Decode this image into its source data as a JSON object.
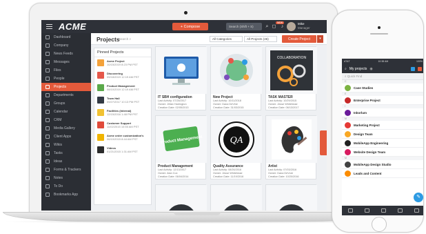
{
  "colors": {
    "accent": "#e35a3b",
    "sidebar": "#2b2e34",
    "topbar": "#2e3138",
    "fab": "#2d9be3"
  },
  "app": {
    "logo": "ACME",
    "compose_label": "+ Compose",
    "search_placeholder": "Search (Shift + S)",
    "badge_new": "NEW",
    "user_name": "Mike",
    "user_role": "Manager"
  },
  "sidebar": {
    "items": [
      {
        "label": "Dashboard",
        "icon": "dashboard-icon"
      },
      {
        "label": "Company",
        "icon": "company-icon"
      },
      {
        "label": "News Feeds",
        "icon": "news-icon"
      },
      {
        "label": "Messages",
        "icon": "messages-icon"
      },
      {
        "label": "Files",
        "icon": "files-icon"
      },
      {
        "label": "People",
        "icon": "people-icon"
      },
      {
        "label": "Projects",
        "icon": "projects-icon",
        "active": true
      },
      {
        "label": "Departments",
        "icon": "departments-icon"
      },
      {
        "label": "Groups",
        "icon": "groups-icon"
      },
      {
        "label": "Calendar",
        "icon": "calendar-icon"
      },
      {
        "label": "CRM",
        "icon": "crm-icon"
      },
      {
        "label": "Media Gallery",
        "icon": "media-icon"
      },
      {
        "label": "Client Apps",
        "icon": "apps-icon"
      },
      {
        "label": "Wikis",
        "icon": "wiki-icon"
      },
      {
        "label": "Tasks",
        "icon": "tasks-icon"
      },
      {
        "label": "Ideas",
        "icon": "ideas-icon"
      },
      {
        "label": "Forms & Trackers",
        "icon": "forms-icon"
      },
      {
        "label": "Notes",
        "icon": "notes-icon"
      },
      {
        "label": "To Do",
        "icon": "todo-icon"
      },
      {
        "label": "Bookmarks App",
        "icon": "bookmarks-icon"
      }
    ]
  },
  "projects": {
    "title": "Projects",
    "search_label": "Search",
    "category_select": "All Categories",
    "projects_select": "All Projects (46)",
    "create_label": "Create Project"
  },
  "pinned": {
    "title": "Pinned Projects",
    "items": [
      {
        "name": "Acme Project",
        "date": "10/15/2019 8:23 PM PST",
        "thumb": "#f4a23a"
      },
      {
        "name": "Discovering",
        "date": "09/18/2019 12:19 AM PST",
        "thumb": "#e5574a"
      },
      {
        "name": "Product Management",
        "date": "08/10/2019 12:19 AM PST",
        "thumb": "#5aa94a"
      },
      {
        "name": "Town Hall",
        "date": "09/27/2017 10:13 PM PST",
        "thumb": "#333a44"
      },
      {
        "name": "Facilities (Internal)",
        "date": "12/15/2016 1:48 PM PST",
        "thumb": "#f1c232"
      },
      {
        "name": "Customer Support",
        "date": "11/02/2015 10:55 AM PST",
        "thumb": "#e04a3a"
      },
      {
        "name": "Acme order customization's",
        "date": "06/10/2015 8:44 AM PST",
        "thumb": "#f0b400"
      },
      {
        "name": "Videos",
        "date": "01/21/2015 1:31 AM PST",
        "thumb": "#2b2b2b"
      }
    ]
  },
  "cards": [
    {
      "title": "IT SBH configuration",
      "last": "Last Activity: 07/28/2017",
      "owner": "Owner: Jillian Harrington",
      "created": "Creation Date: 02/05/2013",
      "img": "monitor"
    },
    {
      "title": "New Project",
      "last": "Last Activity: 10/11/2018",
      "owner": "Owner: Dana DeVine",
      "created": "Creation Date: 31/03/2015",
      "img": "globe"
    },
    {
      "title": "TASK MASTER",
      "last": "Last Activity: 10/29/2015",
      "owner": "Owner: Jesse Whitehead",
      "created": "Creation Date: 06/13/2017",
      "img": "gears",
      "banner": "COLLABORATION"
    },
    {
      "title": "Product Management",
      "last": "Last Activity: 12/13/2017",
      "owner": "Owner: Alan Cox",
      "created": "Creation Date: 06/04/2014",
      "img": "product",
      "banner": "Product Management"
    },
    {
      "title": "Quality Assurance",
      "last": "Last Activity: 08/26/2016",
      "owner": "Owner: Jesse Whitehead",
      "created": "Creation Date: 11/19/2016",
      "img": "qa",
      "banner": "QA"
    },
    {
      "title": "Artist",
      "last": "Last Activity: 07/03/2016",
      "owner": "Owner: Dana DeVore",
      "created": "Creation Date: 10/20/2016",
      "img": "artist"
    }
  ],
  "phone": {
    "carrier": "AT&T",
    "time": "10:38 AM",
    "battery": "100%",
    "header_title": "My projects",
    "search_placeholder": "Quick Find",
    "rows": [
      {
        "section": "C",
        "name": "Case Studies",
        "color": "#7cb342"
      },
      {
        "section": "E",
        "name": "Enterprise Project",
        "color": "#c62828"
      },
      {
        "section": "I",
        "name": "Inkorlum",
        "color": "#6a1b9a"
      },
      {
        "section": "M",
        "name": "Marketing Project",
        "color": "#e53935"
      },
      {
        "section": "",
        "name": "Design Team",
        "color": "#f9a825"
      },
      {
        "section": "",
        "name": "MobileApp Engineering",
        "color": "#212121"
      },
      {
        "section": "",
        "name": "Website Design Team",
        "color": "#d81b60"
      },
      {
        "section": "M",
        "name": "MobileApp Design Studio",
        "color": "#424242"
      },
      {
        "section": "",
        "name": "Leads and Content",
        "color": "#fb8c00"
      }
    ]
  }
}
